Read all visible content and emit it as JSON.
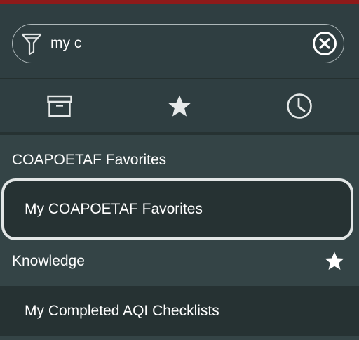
{
  "search": {
    "value": "my c",
    "placeholder": "",
    "filter_icon": "funnel-icon",
    "clear_icon": "clear-circle-icon"
  },
  "tabs": [
    {
      "name": "archive",
      "icon": "archive-box-icon"
    },
    {
      "name": "favorites",
      "icon": "star-icon"
    },
    {
      "name": "history",
      "icon": "clock-icon"
    }
  ],
  "results": {
    "groups": [
      {
        "heading": "COAPOETAF Favorites",
        "items": [
          {
            "label": "My COAPOETAF Favorites",
            "selected": true
          }
        ]
      },
      {
        "heading": "Knowledge",
        "heading_icon": "star-icon",
        "items": [
          {
            "label": "My Completed AQI Checklists",
            "selected": false
          }
        ]
      }
    ]
  },
  "colors": {
    "top_accent": "#8e1a1a",
    "panel_bg": "#2f3e41",
    "section_bg": "#344446",
    "item_bg": "#263233",
    "selection_ring": "#e2e6e6",
    "icon": "#e6e9e9",
    "text": "#ffffff"
  }
}
